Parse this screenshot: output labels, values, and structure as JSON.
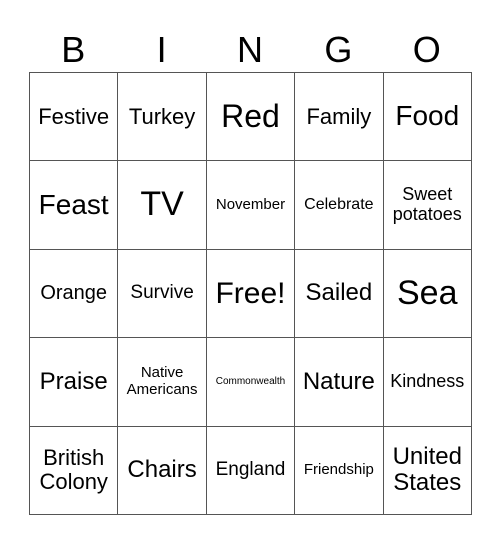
{
  "header": {
    "letters": [
      "B",
      "I",
      "N",
      "G",
      "O"
    ]
  },
  "grid": {
    "rows": [
      [
        "Festive",
        "Turkey",
        "Red",
        "Family",
        "Food"
      ],
      [
        "Feast",
        "TV",
        "November",
        "Celebrate",
        "Sweet potatoes"
      ],
      [
        "Orange",
        "Survive",
        "Free!",
        "Sailed",
        "Sea"
      ],
      [
        "Praise",
        "Native Americans",
        "Commonwealth",
        "Nature",
        "Kindness"
      ],
      [
        "British Colony",
        "Chairs",
        "England",
        "Friendship",
        "United States"
      ]
    ],
    "free_space": "Free!"
  }
}
